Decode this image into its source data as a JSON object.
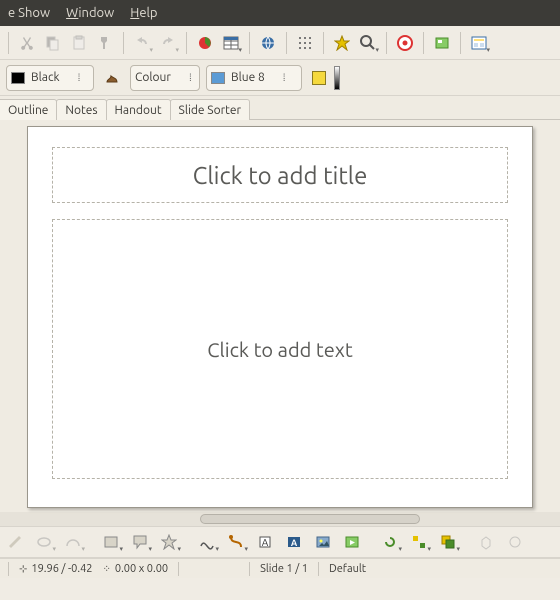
{
  "menubar": {
    "items": [
      "e Show",
      "Window",
      "Help"
    ]
  },
  "color_row": {
    "line_color": "Black",
    "fill_mode": "Colour",
    "fill_color": "Blue 8"
  },
  "view_tabs": [
    "Outline",
    "Notes",
    "Handout",
    "Slide Sorter"
  ],
  "slide": {
    "title_placeholder": "Click to add title",
    "body_placeholder": "Click to add text"
  },
  "statusbar": {
    "cursor": "19.96 / -0.42",
    "size": "0.00 x 0.00",
    "slide_info": "Slide 1 / 1",
    "template": "Default"
  }
}
